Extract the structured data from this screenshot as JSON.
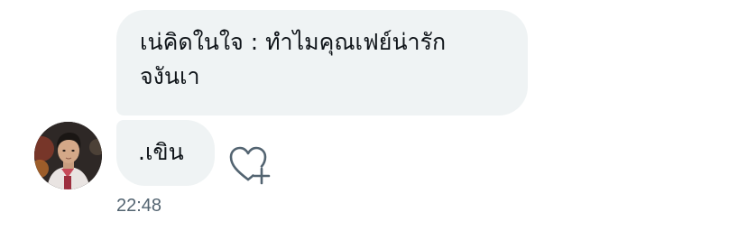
{
  "messages": [
    {
      "lines": [
        "เน่คิดในใจ : ทำไมคุณเฟย์น่ารัก",
        "จงันเา"
      ]
    },
    {
      "text": ".เขิน"
    }
  ],
  "timestamp": "22:48",
  "icons": {
    "like": "heart-plus-icon",
    "avatar": "user-avatar"
  },
  "colors": {
    "bubble_bg": "#eff3f4",
    "text": "#0f1419",
    "meta": "#536471"
  }
}
